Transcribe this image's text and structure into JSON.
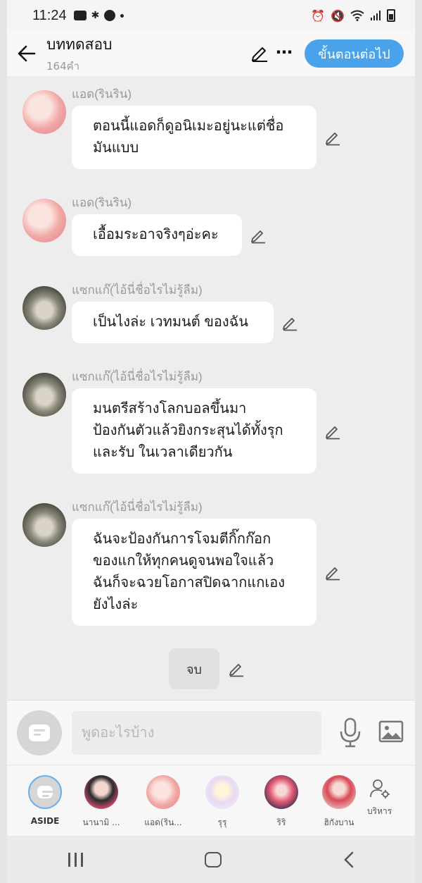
{
  "status_bar": {
    "time": "11:24",
    "left_icons": [
      "youtube-icon",
      "bluetooth-icon",
      "line-icon",
      "dot-icon"
    ],
    "right_icons": [
      "alarm-icon",
      "mute-icon",
      "wifi-icon",
      "signal-icon",
      "battery-icon"
    ]
  },
  "header": {
    "title": "บททดสอบ",
    "subtitle": "164คำ",
    "next_button": "ขั้นตอนต่อไป"
  },
  "messages": [
    {
      "sender": "แอด(รินริน)",
      "avatar": "pink",
      "lines": [
        "ตอนนี้แอดก็ดูอนิเมะอยู่นะแต่ชื่อ",
        "มันแบบ"
      ]
    },
    {
      "sender": "แอด(รินริน)",
      "avatar": "pink",
      "lines": [
        "เอื้อมระอาจริงๆอ่ะคะ"
      ]
    },
    {
      "sender": "แซกแก๊(ไอ้นี่ชื่อไรไม่รู้ลืม)",
      "avatar": "dark",
      "lines": [
        "เป็นไงล่ะ เวทมนต์ ของฉัน"
      ]
    },
    {
      "sender": "แซกแก๊(ไอ้นี่ชื่อไรไม่รู้ลืม)",
      "avatar": "dark",
      "lines": [
        "มนตรีสร้างโลกบอลขึ้นมา",
        "ป้องกันตัวแล้วยิงกระสุนได้ทั้งรุก",
        "และรับ ในเวลาเดียวกัน"
      ]
    },
    {
      "sender": "แซกแก๊(ไอ้นี่ชื่อไรไม่รู้ลืม)",
      "avatar": "dark",
      "lines": [
        "ฉันจะป้องกันการโจมตีกิ๊กก๊อก",
        "ของแกให้ทุกคนดูจนพอใจแล้ว",
        "ฉันก็จะฉวยโอกาสปิดฉากแกเอง",
        "ยังไงล่ะ"
      ]
    }
  ],
  "end_label": "จบ",
  "input": {
    "placeholder": "พูดอะไรบ้าง",
    "value": ""
  },
  "characters": [
    {
      "label": "ASIDE"
    },
    {
      "label": "นานามิ ..."
    },
    {
      "label": "แอด(ริน..."
    },
    {
      "label": "รุรุ"
    },
    {
      "label": "ริริ"
    },
    {
      "label": "ฮิกังบาน"
    }
  ],
  "manage_label": "บริหาร",
  "colors": {
    "accent": "#4aa3ea",
    "background": "#ededed",
    "bubble": "#ffffff"
  }
}
